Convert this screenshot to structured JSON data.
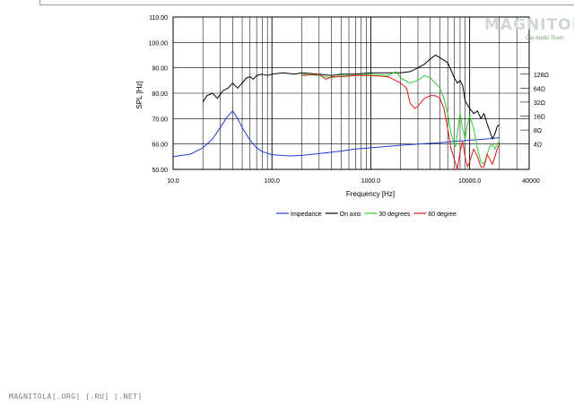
{
  "watermark": {
    "text": "MAGNITOLA",
    "subtext": "Car Audio Team"
  },
  "footer": "MAGNITOLA[.ORG] [.RU] [.NET]",
  "chart_data": {
    "type": "line",
    "ylabel": "SPL [Hz]",
    "xlabel": "Frequency [Hz]",
    "x_scale": "log",
    "xlim": [
      10,
      40000
    ],
    "ylim": [
      50,
      110
    ],
    "grid": true,
    "legend_position": "bottom",
    "x_ticks": [
      "10.0",
      "100.0",
      "1000.0",
      "10000.0",
      "40000"
    ],
    "y_ticks": [
      "110.00",
      "100.00",
      "90.00",
      "80.00",
      "70.00",
      "60.00",
      "50.00"
    ],
    "y2_ticks": [
      "128Ω",
      "64Ω",
      "32Ω",
      "16Ω",
      "8Ω",
      "4Ω"
    ],
    "y2_values": [
      87.5,
      82,
      76.5,
      71,
      65.5,
      60
    ],
    "series": [
      {
        "name": "Impedance",
        "color": "#1f3fd8",
        "points": [
          [
            10,
            55
          ],
          [
            15,
            56
          ],
          [
            20,
            58.5
          ],
          [
            25,
            62
          ],
          [
            30,
            66.5
          ],
          [
            35,
            70.5
          ],
          [
            40,
            73
          ],
          [
            45,
            70
          ],
          [
            50,
            66.5
          ],
          [
            60,
            61.5
          ],
          [
            70,
            58.5
          ],
          [
            80,
            57
          ],
          [
            100,
            55.8
          ],
          [
            150,
            55.3
          ],
          [
            200,
            55.5
          ],
          [
            300,
            56.2
          ],
          [
            500,
            57.2
          ],
          [
            700,
            58
          ],
          [
            1000,
            58.5
          ],
          [
            2000,
            59.5
          ],
          [
            3000,
            60
          ],
          [
            5000,
            60.5
          ],
          [
            7000,
            61
          ],
          [
            10000,
            61.5
          ],
          [
            15000,
            62
          ],
          [
            20000,
            62.5
          ]
        ]
      },
      {
        "name": "On axis",
        "color": "#000000",
        "points": [
          [
            20,
            76.5
          ],
          [
            22,
            79
          ],
          [
            25,
            80
          ],
          [
            28,
            78
          ],
          [
            32,
            81
          ],
          [
            36,
            82
          ],
          [
            40,
            84
          ],
          [
            45,
            82
          ],
          [
            50,
            84
          ],
          [
            55,
            86
          ],
          [
            60,
            86.5
          ],
          [
            65,
            85.5
          ],
          [
            70,
            87
          ],
          [
            80,
            87.5
          ],
          [
            90,
            87
          ],
          [
            100,
            87.5
          ],
          [
            130,
            88
          ],
          [
            170,
            87.5
          ],
          [
            200,
            88
          ],
          [
            300,
            87.5
          ],
          [
            400,
            87
          ],
          [
            500,
            87.5
          ],
          [
            700,
            87.5
          ],
          [
            1000,
            88
          ],
          [
            1500,
            88
          ],
          [
            2000,
            88
          ],
          [
            2500,
            88.5
          ],
          [
            3000,
            90
          ],
          [
            3500,
            91.5
          ],
          [
            4000,
            93.5
          ],
          [
            4500,
            95
          ],
          [
            5000,
            94
          ],
          [
            5500,
            93
          ],
          [
            6000,
            92
          ],
          [
            6500,
            89
          ],
          [
            7000,
            86
          ],
          [
            7500,
            84
          ],
          [
            8000,
            85
          ],
          [
            8500,
            83
          ],
          [
            9000,
            77
          ],
          [
            10000,
            74
          ],
          [
            11000,
            72
          ],
          [
            12000,
            73
          ],
          [
            13000,
            70
          ],
          [
            14000,
            72
          ],
          [
            15000,
            68
          ],
          [
            16000,
            65
          ],
          [
            17000,
            62
          ],
          [
            18000,
            64
          ],
          [
            19000,
            67
          ],
          [
            20000,
            67.5
          ]
        ]
      },
      {
        "name": "30 degrees",
        "color": "#2ecf2e",
        "points": [
          [
            200,
            87.5
          ],
          [
            300,
            87
          ],
          [
            400,
            86
          ],
          [
            500,
            87
          ],
          [
            700,
            87
          ],
          [
            1000,
            87.5
          ],
          [
            1500,
            87
          ],
          [
            1800,
            88.5
          ],
          [
            2000,
            86
          ],
          [
            2500,
            84
          ],
          [
            3000,
            85
          ],
          [
            3500,
            87
          ],
          [
            4000,
            86
          ],
          [
            4500,
            84
          ],
          [
            5000,
            82
          ],
          [
            5500,
            78
          ],
          [
            6000,
            72
          ],
          [
            6500,
            64
          ],
          [
            7000,
            60
          ],
          [
            7200,
            59
          ],
          [
            7500,
            64
          ],
          [
            8000,
            72
          ],
          [
            8500,
            66
          ],
          [
            9000,
            62
          ],
          [
            9500,
            68
          ],
          [
            10000,
            71
          ],
          [
            11000,
            66
          ],
          [
            12000,
            58
          ],
          [
            13000,
            53
          ],
          [
            14000,
            52
          ],
          [
            15000,
            56
          ],
          [
            16000,
            59
          ],
          [
            17000,
            60
          ],
          [
            18000,
            58
          ],
          [
            19000,
            60
          ],
          [
            20000,
            61
          ]
        ]
      },
      {
        "name": "60 degree",
        "color": "#e01818",
        "points": [
          [
            200,
            87
          ],
          [
            300,
            87.5
          ],
          [
            350,
            85.5
          ],
          [
            400,
            86.5
          ],
          [
            500,
            86.5
          ],
          [
            700,
            87
          ],
          [
            1000,
            87
          ],
          [
            1500,
            86.5
          ],
          [
            2000,
            84
          ],
          [
            2300,
            82
          ],
          [
            2500,
            76
          ],
          [
            2800,
            74
          ],
          [
            3000,
            75
          ],
          [
            3500,
            78
          ],
          [
            4000,
            79
          ],
          [
            4500,
            79
          ],
          [
            5000,
            78
          ],
          [
            5500,
            74
          ],
          [
            6000,
            66
          ],
          [
            6500,
            58
          ],
          [
            7000,
            54
          ],
          [
            7500,
            50
          ],
          [
            8000,
            57
          ],
          [
            8500,
            61
          ],
          [
            9000,
            55
          ],
          [
            9500,
            51
          ],
          [
            10000,
            53
          ],
          [
            11000,
            58
          ],
          [
            12000,
            55
          ],
          [
            13000,
            51
          ],
          [
            14000,
            51
          ],
          [
            15000,
            56
          ],
          [
            16000,
            54
          ],
          [
            17000,
            52
          ],
          [
            18000,
            55
          ],
          [
            19000,
            58
          ],
          [
            20000,
            60
          ]
        ]
      }
    ]
  }
}
